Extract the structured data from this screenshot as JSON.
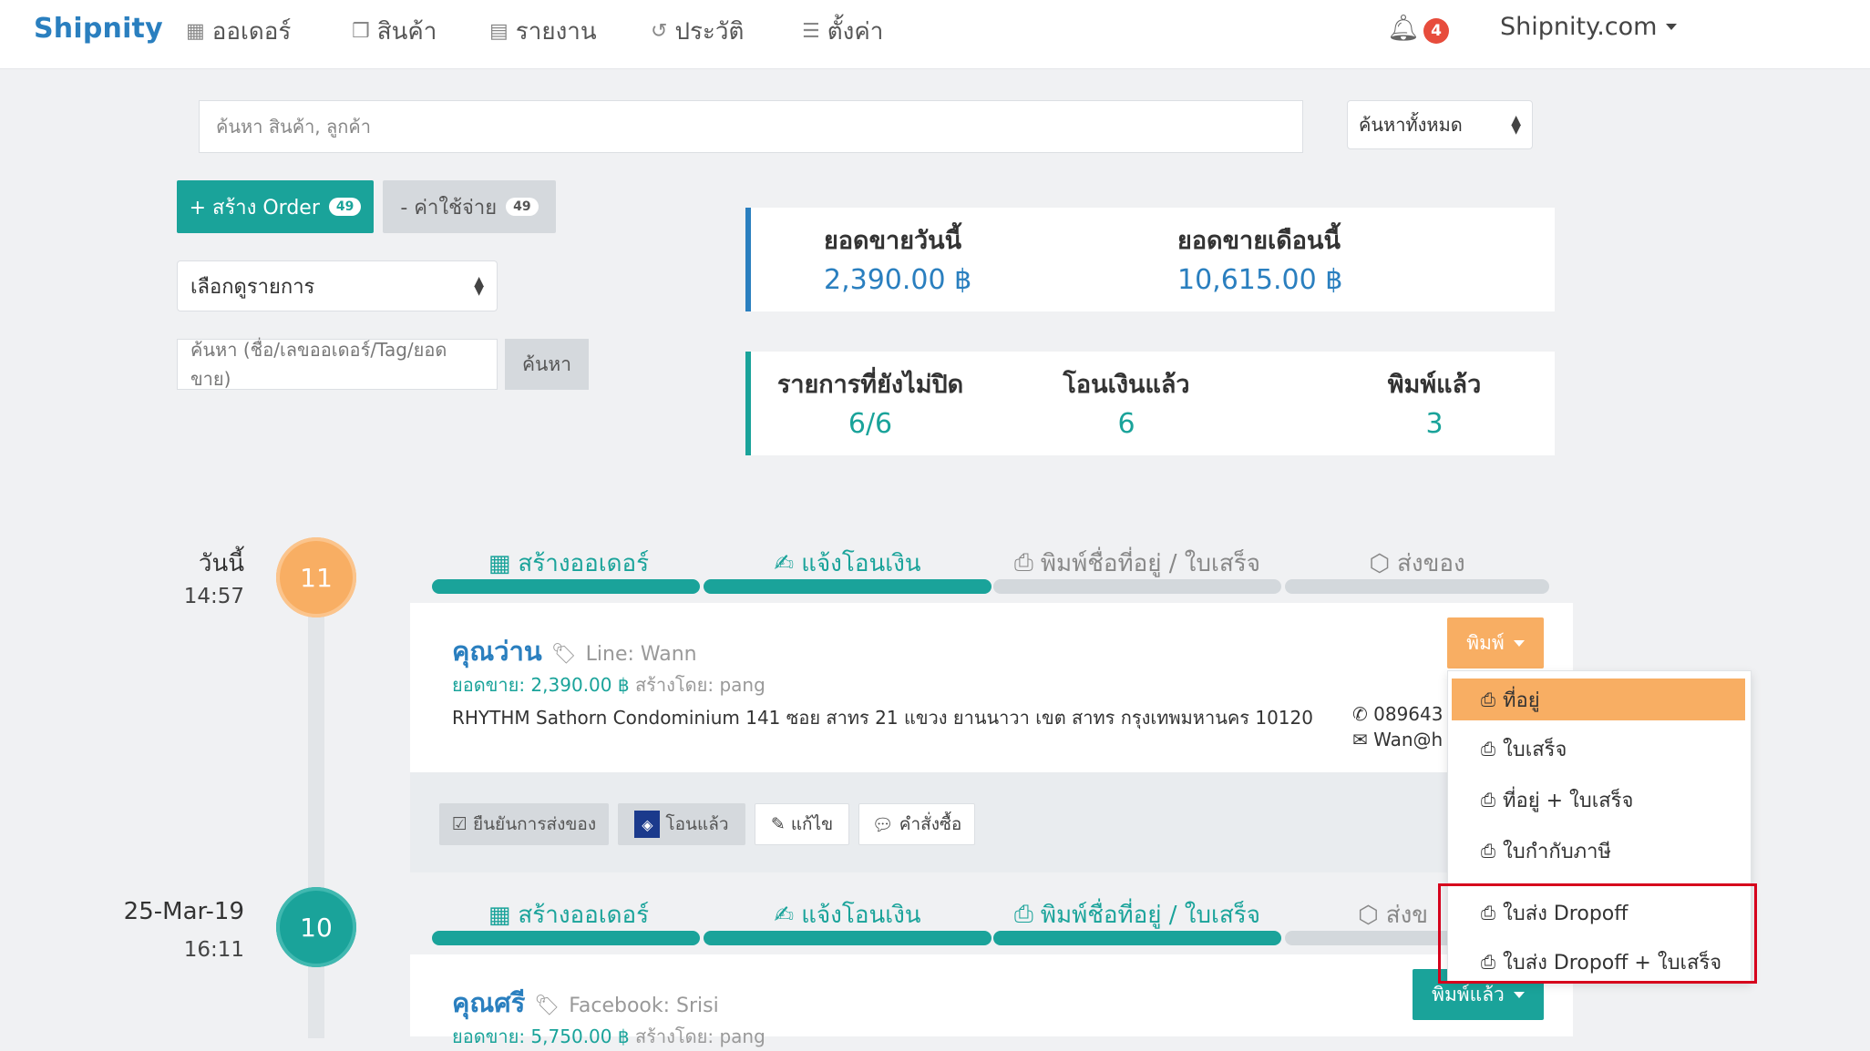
{
  "navbar": {
    "brand": "Shipnity",
    "items": [
      {
        "label": "ออเดอร์",
        "icon": "orders-icon"
      },
      {
        "label": "สินค้า",
        "icon": "product-icon"
      },
      {
        "label": "รายงาน",
        "icon": "report-icon"
      },
      {
        "label": "ประวัติ",
        "icon": "history-icon"
      },
      {
        "label": "ตั้งค่า",
        "icon": "settings-icon"
      }
    ],
    "notification_count": "4",
    "account": "Shipnity.com"
  },
  "search": {
    "placeholder": "ค้นหา   สินค้า, ลูกค้า",
    "scope": "ค้นหาทั้งหมด"
  },
  "actions": {
    "create_label": "+ สร้าง Order",
    "create_count": "49",
    "expense_label": "- ค่าใช้จ่าย",
    "expense_count": "49",
    "view_select": "เลือกดูรายการ",
    "order_search_placeholder": "ค้นหา (ชื่อ/เลขออเดอร์/Tag/ยอดขาย)",
    "order_search_button": "ค้นหา"
  },
  "stats": {
    "today_label": "ยอดขายวันนี้",
    "today_value": "2,390.00 ฿",
    "month_label": "ยอดขายเดือนนี้",
    "month_value": "10,615.00 ฿",
    "open_label": "รายการที่ยังไม่ปิด",
    "open_value": "6/6",
    "paid_label": "โอนเงินแล้ว",
    "paid_value": "6",
    "printed_label": "พิมพ์แล้ว",
    "printed_value": "3"
  },
  "steps": [
    "สร้างออเดอร์",
    "แจ้งโอนเงิน",
    "พิมพ์ชื่อที่อยู่ / ใบเสร็จ",
    "ส่งของ"
  ],
  "step2_last_label": "ส่งข",
  "orders": [
    {
      "date": "วันนี้",
      "time": "14:57",
      "number": "11",
      "customer": "คุณว่าน",
      "tag": "Line: Wann",
      "sales": "ยอดขาย: 2,390.00 ฿",
      "created_by": "สร้างโดย: pang",
      "address": "RHYTHM Sathorn Condominium 141 ซอย สาทร 21 แขวง ยานนาวา เขต สาทร กรุงเทพมหานคร 10120",
      "phone": "089643",
      "email": "Wan@h",
      "print_button": "พิมพ์",
      "footer_buttons": [
        "ยืนยันการส่งของ",
        "โอนแล้ว",
        "แก้ไข",
        "คำสั่งซื้อ"
      ]
    },
    {
      "date": "25-Mar-19",
      "time": "16:11",
      "number": "10",
      "customer": "คุณศรี",
      "tag": "Facebook: Srisi",
      "sales": "ยอดขาย: 5,750.00 ฿",
      "created_by": "สร้างโดย: pang",
      "print_button": "พิมพ์แล้ว"
    }
  ],
  "print_menu": [
    "ที่อยู่",
    "ใบเสร็จ",
    "ที่อยู่ + ใบเสร็จ",
    "ใบกำกับภาษี",
    "ใบส่ง Dropoff",
    "ใบส่ง Dropoff + ใบเสร็จ"
  ],
  "colors": {
    "brand_blue": "#2a7fbf",
    "teal": "#1aa39a",
    "orange": "#f8ae63",
    "badge_red": "#e74c3c",
    "highlight_red": "#d6001c"
  }
}
